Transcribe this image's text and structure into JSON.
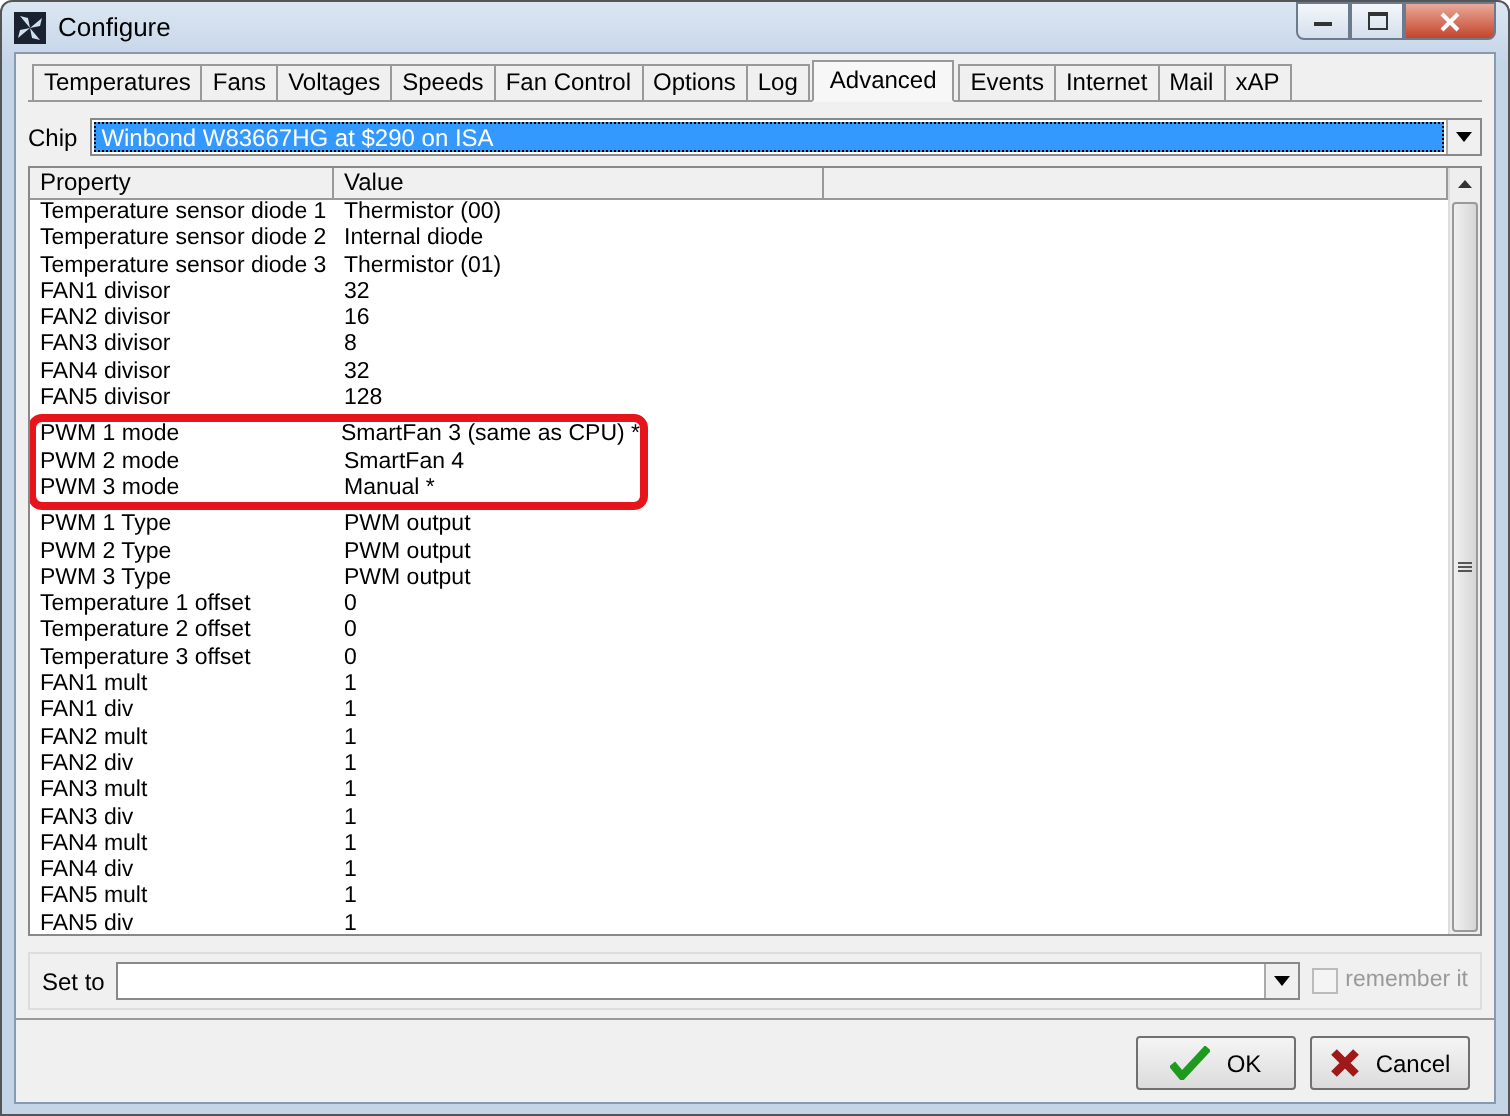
{
  "window": {
    "title": "Configure"
  },
  "tabs": [
    {
      "label": "Temperatures",
      "selected": false
    },
    {
      "label": "Fans",
      "selected": false
    },
    {
      "label": "Voltages",
      "selected": false
    },
    {
      "label": "Speeds",
      "selected": false
    },
    {
      "label": "Fan Control",
      "selected": false
    },
    {
      "label": "Options",
      "selected": false
    },
    {
      "label": "Log",
      "selected": false
    },
    {
      "label": "Advanced",
      "selected": true
    },
    {
      "label": "Events",
      "selected": false
    },
    {
      "label": "Internet",
      "selected": false
    },
    {
      "label": "Mail",
      "selected": false
    },
    {
      "label": "xAP",
      "selected": false
    }
  ],
  "chip": {
    "label": "Chip",
    "value": "Winbond W83667HG at $290 on ISA"
  },
  "table": {
    "columns": [
      "Property",
      "Value"
    ],
    "rows": [
      {
        "property": "Temperature sensor diode 1",
        "value": "Thermistor (00)",
        "highlighted": false
      },
      {
        "property": "Temperature sensor diode 2",
        "value": "Internal diode",
        "highlighted": false
      },
      {
        "property": "Temperature sensor diode 3",
        "value": "Thermistor (01)",
        "highlighted": false
      },
      {
        "property": "FAN1 divisor",
        "value": "32",
        "highlighted": false
      },
      {
        "property": "FAN2 divisor",
        "value": "16",
        "highlighted": false
      },
      {
        "property": "FAN3 divisor",
        "value": "8",
        "highlighted": false
      },
      {
        "property": "FAN4 divisor",
        "value": "32",
        "highlighted": false
      },
      {
        "property": "FAN5 divisor",
        "value": "128",
        "highlighted": false
      },
      {
        "property": "PWM 1 mode",
        "value": "SmartFan 3 (same as CPU) *",
        "highlighted": true
      },
      {
        "property": "PWM 2 mode",
        "value": "SmartFan 4",
        "highlighted": true
      },
      {
        "property": "PWM 3 mode",
        "value": "Manual *",
        "highlighted": true
      },
      {
        "property": "PWM 1 Type",
        "value": "PWM output",
        "highlighted": false
      },
      {
        "property": "PWM 2 Type",
        "value": "PWM output",
        "highlighted": false
      },
      {
        "property": "PWM 3 Type",
        "value": "PWM output",
        "highlighted": false
      },
      {
        "property": "Temperature 1 offset",
        "value": "0",
        "highlighted": false
      },
      {
        "property": "Temperature 2 offset",
        "value": "0",
        "highlighted": false
      },
      {
        "property": "Temperature 3 offset",
        "value": "0",
        "highlighted": false
      },
      {
        "property": "FAN1 mult",
        "value": "1",
        "highlighted": false
      },
      {
        "property": "FAN1 div",
        "value": "1",
        "highlighted": false
      },
      {
        "property": "FAN2 mult",
        "value": "1",
        "highlighted": false
      },
      {
        "property": "FAN2 div",
        "value": "1",
        "highlighted": false
      },
      {
        "property": "FAN3 mult",
        "value": "1",
        "highlighted": false
      },
      {
        "property": "FAN3 div",
        "value": "1",
        "highlighted": false
      },
      {
        "property": "FAN4 mult",
        "value": "1",
        "highlighted": false
      },
      {
        "property": "FAN4 div",
        "value": "1",
        "highlighted": false
      },
      {
        "property": "FAN5 mult",
        "value": "1",
        "highlighted": false
      },
      {
        "property": "FAN5 div",
        "value": "1",
        "highlighted": false
      }
    ]
  },
  "set_to": {
    "label": "Set to"
  },
  "remember_it": {
    "label": "remember it",
    "checked": false,
    "disabled": true
  },
  "buttons": [
    {
      "label": "OK",
      "kind": "ok"
    },
    {
      "label": "Cancel",
      "kind": "cancel"
    }
  ]
}
